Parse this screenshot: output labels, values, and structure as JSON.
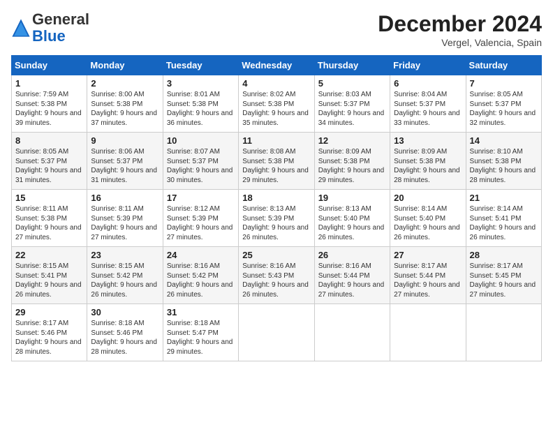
{
  "header": {
    "logo_general": "General",
    "logo_blue": "Blue",
    "title": "December 2024",
    "location": "Vergel, Valencia, Spain"
  },
  "days_of_week": [
    "Sunday",
    "Monday",
    "Tuesday",
    "Wednesday",
    "Thursday",
    "Friday",
    "Saturday"
  ],
  "weeks": [
    [
      {
        "day": "1",
        "sunrise": "7:59 AM",
        "sunset": "5:38 PM",
        "daylight": "9 hours and 39 minutes."
      },
      {
        "day": "2",
        "sunrise": "8:00 AM",
        "sunset": "5:38 PM",
        "daylight": "9 hours and 37 minutes."
      },
      {
        "day": "3",
        "sunrise": "8:01 AM",
        "sunset": "5:38 PM",
        "daylight": "9 hours and 36 minutes."
      },
      {
        "day": "4",
        "sunrise": "8:02 AM",
        "sunset": "5:38 PM",
        "daylight": "9 hours and 35 minutes."
      },
      {
        "day": "5",
        "sunrise": "8:03 AM",
        "sunset": "5:37 PM",
        "daylight": "9 hours and 34 minutes."
      },
      {
        "day": "6",
        "sunrise": "8:04 AM",
        "sunset": "5:37 PM",
        "daylight": "9 hours and 33 minutes."
      },
      {
        "day": "7",
        "sunrise": "8:05 AM",
        "sunset": "5:37 PM",
        "daylight": "9 hours and 32 minutes."
      }
    ],
    [
      {
        "day": "8",
        "sunrise": "8:05 AM",
        "sunset": "5:37 PM",
        "daylight": "9 hours and 31 minutes."
      },
      {
        "day": "9",
        "sunrise": "8:06 AM",
        "sunset": "5:37 PM",
        "daylight": "9 hours and 31 minutes."
      },
      {
        "day": "10",
        "sunrise": "8:07 AM",
        "sunset": "5:37 PM",
        "daylight": "9 hours and 30 minutes."
      },
      {
        "day": "11",
        "sunrise": "8:08 AM",
        "sunset": "5:38 PM",
        "daylight": "9 hours and 29 minutes."
      },
      {
        "day": "12",
        "sunrise": "8:09 AM",
        "sunset": "5:38 PM",
        "daylight": "9 hours and 29 minutes."
      },
      {
        "day": "13",
        "sunrise": "8:09 AM",
        "sunset": "5:38 PM",
        "daylight": "9 hours and 28 minutes."
      },
      {
        "day": "14",
        "sunrise": "8:10 AM",
        "sunset": "5:38 PM",
        "daylight": "9 hours and 28 minutes."
      }
    ],
    [
      {
        "day": "15",
        "sunrise": "8:11 AM",
        "sunset": "5:38 PM",
        "daylight": "9 hours and 27 minutes."
      },
      {
        "day": "16",
        "sunrise": "8:11 AM",
        "sunset": "5:39 PM",
        "daylight": "9 hours and 27 minutes."
      },
      {
        "day": "17",
        "sunrise": "8:12 AM",
        "sunset": "5:39 PM",
        "daylight": "9 hours and 27 minutes."
      },
      {
        "day": "18",
        "sunrise": "8:13 AM",
        "sunset": "5:39 PM",
        "daylight": "9 hours and 26 minutes."
      },
      {
        "day": "19",
        "sunrise": "8:13 AM",
        "sunset": "5:40 PM",
        "daylight": "9 hours and 26 minutes."
      },
      {
        "day": "20",
        "sunrise": "8:14 AM",
        "sunset": "5:40 PM",
        "daylight": "9 hours and 26 minutes."
      },
      {
        "day": "21",
        "sunrise": "8:14 AM",
        "sunset": "5:41 PM",
        "daylight": "9 hours and 26 minutes."
      }
    ],
    [
      {
        "day": "22",
        "sunrise": "8:15 AM",
        "sunset": "5:41 PM",
        "daylight": "9 hours and 26 minutes."
      },
      {
        "day": "23",
        "sunrise": "8:15 AM",
        "sunset": "5:42 PM",
        "daylight": "9 hours and 26 minutes."
      },
      {
        "day": "24",
        "sunrise": "8:16 AM",
        "sunset": "5:42 PM",
        "daylight": "9 hours and 26 minutes."
      },
      {
        "day": "25",
        "sunrise": "8:16 AM",
        "sunset": "5:43 PM",
        "daylight": "9 hours and 26 minutes."
      },
      {
        "day": "26",
        "sunrise": "8:16 AM",
        "sunset": "5:44 PM",
        "daylight": "9 hours and 27 minutes."
      },
      {
        "day": "27",
        "sunrise": "8:17 AM",
        "sunset": "5:44 PM",
        "daylight": "9 hours and 27 minutes."
      },
      {
        "day": "28",
        "sunrise": "8:17 AM",
        "sunset": "5:45 PM",
        "daylight": "9 hours and 27 minutes."
      }
    ],
    [
      {
        "day": "29",
        "sunrise": "8:17 AM",
        "sunset": "5:46 PM",
        "daylight": "9 hours and 28 minutes."
      },
      {
        "day": "30",
        "sunrise": "8:18 AM",
        "sunset": "5:46 PM",
        "daylight": "9 hours and 28 minutes."
      },
      {
        "day": "31",
        "sunrise": "8:18 AM",
        "sunset": "5:47 PM",
        "daylight": "9 hours and 29 minutes."
      },
      null,
      null,
      null,
      null
    ]
  ]
}
